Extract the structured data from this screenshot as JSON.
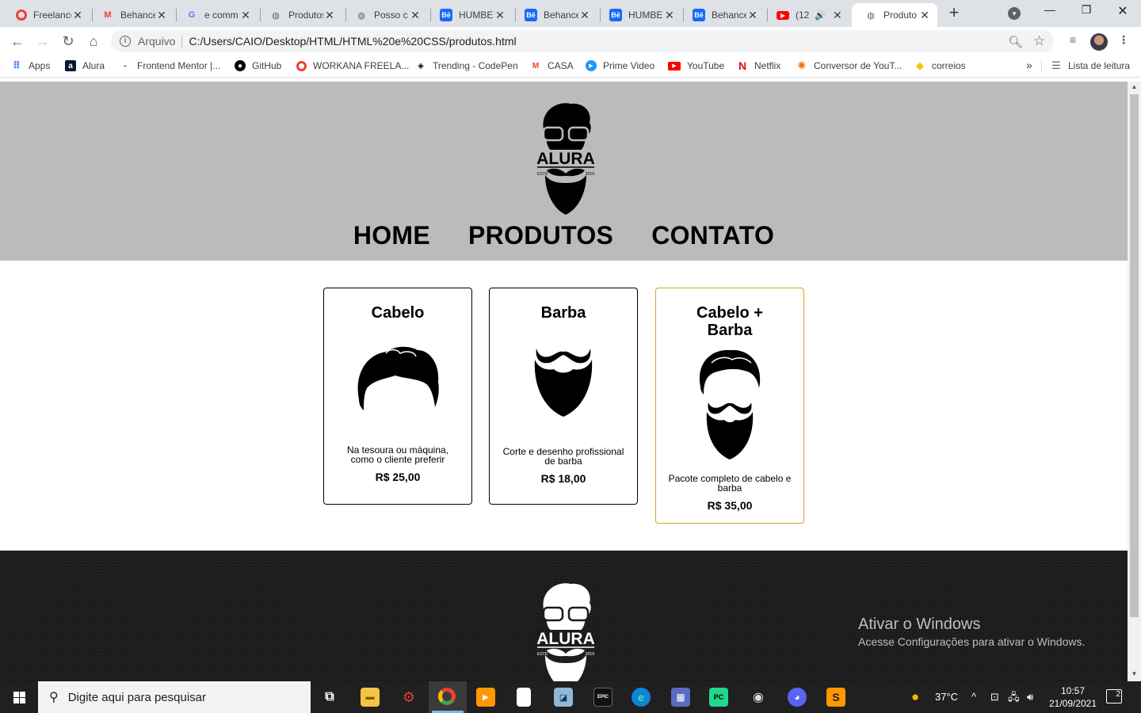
{
  "browser": {
    "tabs": [
      {
        "title": "Freelancer",
        "icon": "chrome-icon"
      },
      {
        "title": "Behance",
        "icon": "gmail-icon"
      },
      {
        "title": "e comm",
        "icon": "google-icon"
      },
      {
        "title": "Produtos",
        "icon": "globe-icon"
      },
      {
        "title": "Posso c",
        "icon": "globe-icon"
      },
      {
        "title": "HUMBE",
        "icon": "behance-icon"
      },
      {
        "title": "Behance",
        "icon": "behance-icon"
      },
      {
        "title": "HUMBE",
        "icon": "behance-icon"
      },
      {
        "title": "Behance",
        "icon": "behance-icon"
      },
      {
        "title": "(12",
        "icon": "youtube-icon"
      },
      {
        "title": "Produto",
        "icon": "globe-icon",
        "active": true
      }
    ],
    "address": {
      "scheme_label": "Arquivo",
      "url": "C:/Users/CAIO/Desktop/HTML/HTML%20e%20CSS/produtos.html"
    },
    "bookmarks": [
      {
        "label": "Apps",
        "icon": "apps-grid-icon"
      },
      {
        "label": "Alura",
        "icon": "alura-icon"
      },
      {
        "label": "Frontend Mentor |...",
        "icon": "frontend-mentor-icon"
      },
      {
        "label": "GitHub",
        "icon": "github-icon"
      },
      {
        "label": "WORKANA FREELA...",
        "icon": "workana-icon"
      },
      {
        "label": "Trending - CodePen",
        "icon": "codepen-icon"
      },
      {
        "label": "CASA",
        "icon": "gmail-icon"
      },
      {
        "label": "Prime Video",
        "icon": "prime-video-icon"
      },
      {
        "label": "YouTube",
        "icon": "youtube-icon"
      },
      {
        "label": "Netflix",
        "icon": "netflix-icon"
      },
      {
        "label": "Conversor de YouT...",
        "icon": "converter-icon"
      },
      {
        "label": "correios",
        "icon": "correios-icon"
      }
    ],
    "reading_list": "Lista de leitura",
    "more_bookmarks": "»"
  },
  "page": {
    "logo_text": "ALURA",
    "logo_estd": "ESTD",
    "logo_year": "2019",
    "nav": [
      "HOME",
      "PRODUTOS",
      "CONTATO"
    ],
    "products": [
      {
        "name": "Cabelo",
        "description": "Na tesoura ou máquina, como o cliente preferir",
        "price": "R$ 25,00"
      },
      {
        "name": "Barba",
        "description": "Corte e desenho profissional de barba",
        "price": "R$ 18,00"
      },
      {
        "name": "Cabelo + Barba",
        "description": "Pacote completo de cabelo e barba",
        "price": "R$ 35,00"
      }
    ],
    "watermark": {
      "title": "Ativar o Windows",
      "subtitle": "Acesse Configurações para ativar o Windows."
    }
  },
  "taskbar": {
    "search_placeholder": "Digite aqui para pesquisar",
    "temperature": "37°C",
    "time": "10:57",
    "date": "21/09/2021",
    "notifications": "2"
  },
  "colors": {
    "header_bg": "#bbbbbb",
    "combo_border": "#d4a52c",
    "footer_bg": "#1c1c1c"
  }
}
